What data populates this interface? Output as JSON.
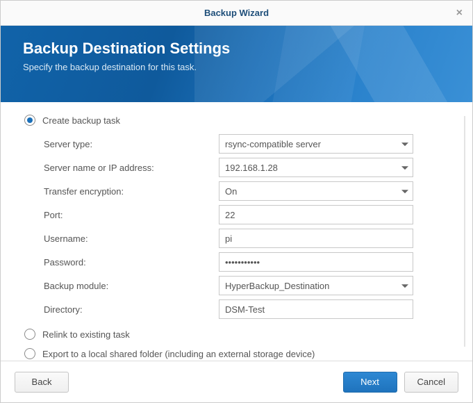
{
  "window": {
    "title": "Backup Wizard",
    "close_label": "×"
  },
  "banner": {
    "heading": "Backup Destination Settings",
    "subheading": "Specify the backup destination for this task."
  },
  "options": {
    "create": "Create backup task",
    "relink": "Relink to existing task",
    "export": "Export to a local shared folder (including an external storage device)"
  },
  "form": {
    "server_type": {
      "label": "Server type:",
      "value": "rsync-compatible server"
    },
    "server_addr": {
      "label": "Server name or IP address:",
      "value": "192.168.1.28"
    },
    "encryption": {
      "label": "Transfer encryption:",
      "value": "On"
    },
    "port": {
      "label": "Port:",
      "value": "22"
    },
    "username": {
      "label": "Username:",
      "value": "pi"
    },
    "password": {
      "label": "Password:",
      "value": "•••••••••••"
    },
    "backup_module": {
      "label": "Backup module:",
      "value": "HyperBackup_Destination"
    },
    "directory": {
      "label": "Directory:",
      "value": "DSM-Test"
    }
  },
  "buttons": {
    "back": "Back",
    "next": "Next",
    "cancel": "Cancel"
  }
}
